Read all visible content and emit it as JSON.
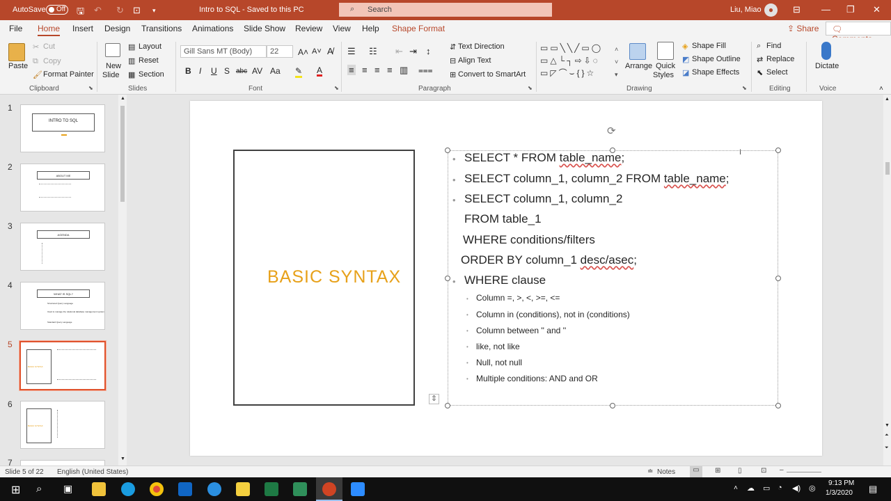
{
  "titlebar": {
    "autosave_label": "AutoSave",
    "autosave_state": "Off",
    "doc_title": "Intro to SQL  -  Saved to this PC",
    "search_placeholder": "Search",
    "user_name": "Liu, Miao"
  },
  "tabs": [
    "File",
    "Home",
    "Insert",
    "Design",
    "Transitions",
    "Animations",
    "Slide Show",
    "Review",
    "View",
    "Help",
    "Shape Format"
  ],
  "tab_actions": {
    "share": "Share",
    "comments": "Comments"
  },
  "ribbon": {
    "clipboard": {
      "paste": "Paste",
      "cut": "Cut",
      "copy": "Copy",
      "format_painter": "Format Painter",
      "group": "Clipboard"
    },
    "slides": {
      "new_slide_1": "New",
      "new_slide_2": "Slide",
      "layout": "Layout",
      "reset": "Reset",
      "section": "Section",
      "group": "Slides"
    },
    "font": {
      "name": "Gill Sans MT (Body)",
      "size": "22",
      "group": "Font",
      "bold": "B",
      "italic": "I",
      "underline": "U",
      "strike": "S",
      "shadow": "abc",
      "case": "Aa"
    },
    "paragraph": {
      "text_direction": "Text Direction",
      "align_text": "Align Text",
      "smartart": "Convert to SmartArt",
      "group": "Paragraph"
    },
    "drawing": {
      "arrange": "Arrange",
      "quick_styles_1": "Quick",
      "quick_styles_2": "Styles",
      "shape_fill": "Shape Fill",
      "shape_outline": "Shape Outline",
      "shape_effects": "Shape Effects",
      "group": "Drawing"
    },
    "editing": {
      "find": "Find",
      "replace": "Replace",
      "select": "Select",
      "group": "Editing"
    },
    "voice": {
      "dictate": "Dictate",
      "group": "Voice"
    }
  },
  "thumbnails": {
    "numbers": [
      "1",
      "2",
      "3",
      "4",
      "5",
      "6",
      "7"
    ],
    "slide1_title": "INTRO TO SQL",
    "slide2_title": "ABOUT ME",
    "slide3_title": "AGENDA",
    "slide4_title": "WHAT IS SQL?",
    "slide4_lines": [
      "Structured Query Language",
      "Used to manage the relational database management system",
      "Standard Query Language"
    ],
    "slide5_title": "BASIC SYNTAX",
    "slide6_title": "BASIC SYNTAX"
  },
  "slide": {
    "title": "BASIC SYNTAX",
    "lines": [
      {
        "pre": "SELECT * FROM ",
        "sq": "table_name",
        ";": ";"
      },
      {
        "pre": "SELECT column_1, column_2 FROM ",
        "sq": "table_name",
        ";": ";"
      },
      {
        "pre": "SELECT column_1, column_2",
        "sq": "",
        ";": ""
      }
    ],
    "from_line": "FROM table_1",
    "where_line": "WHERE conditions/filters",
    "order_pre": "ORDER BY column_1 ",
    "order_sq": "desc/asec",
    "order_post": ";",
    "where_clause": "WHERE clause",
    "sub_bullets": [
      "Column =, >, <, >=, <=",
      "Column in (conditions), not in (conditions)",
      "Column between '' and ''",
      "like, not like",
      "Null, not null",
      "Multiple conditions: AND and OR"
    ]
  },
  "status": {
    "slide_info": "Slide 5 of 22",
    "language": "English (United States)",
    "notes": "Notes"
  },
  "taskbar": {
    "time": "9:13 PM",
    "date": "1/3/2020"
  }
}
